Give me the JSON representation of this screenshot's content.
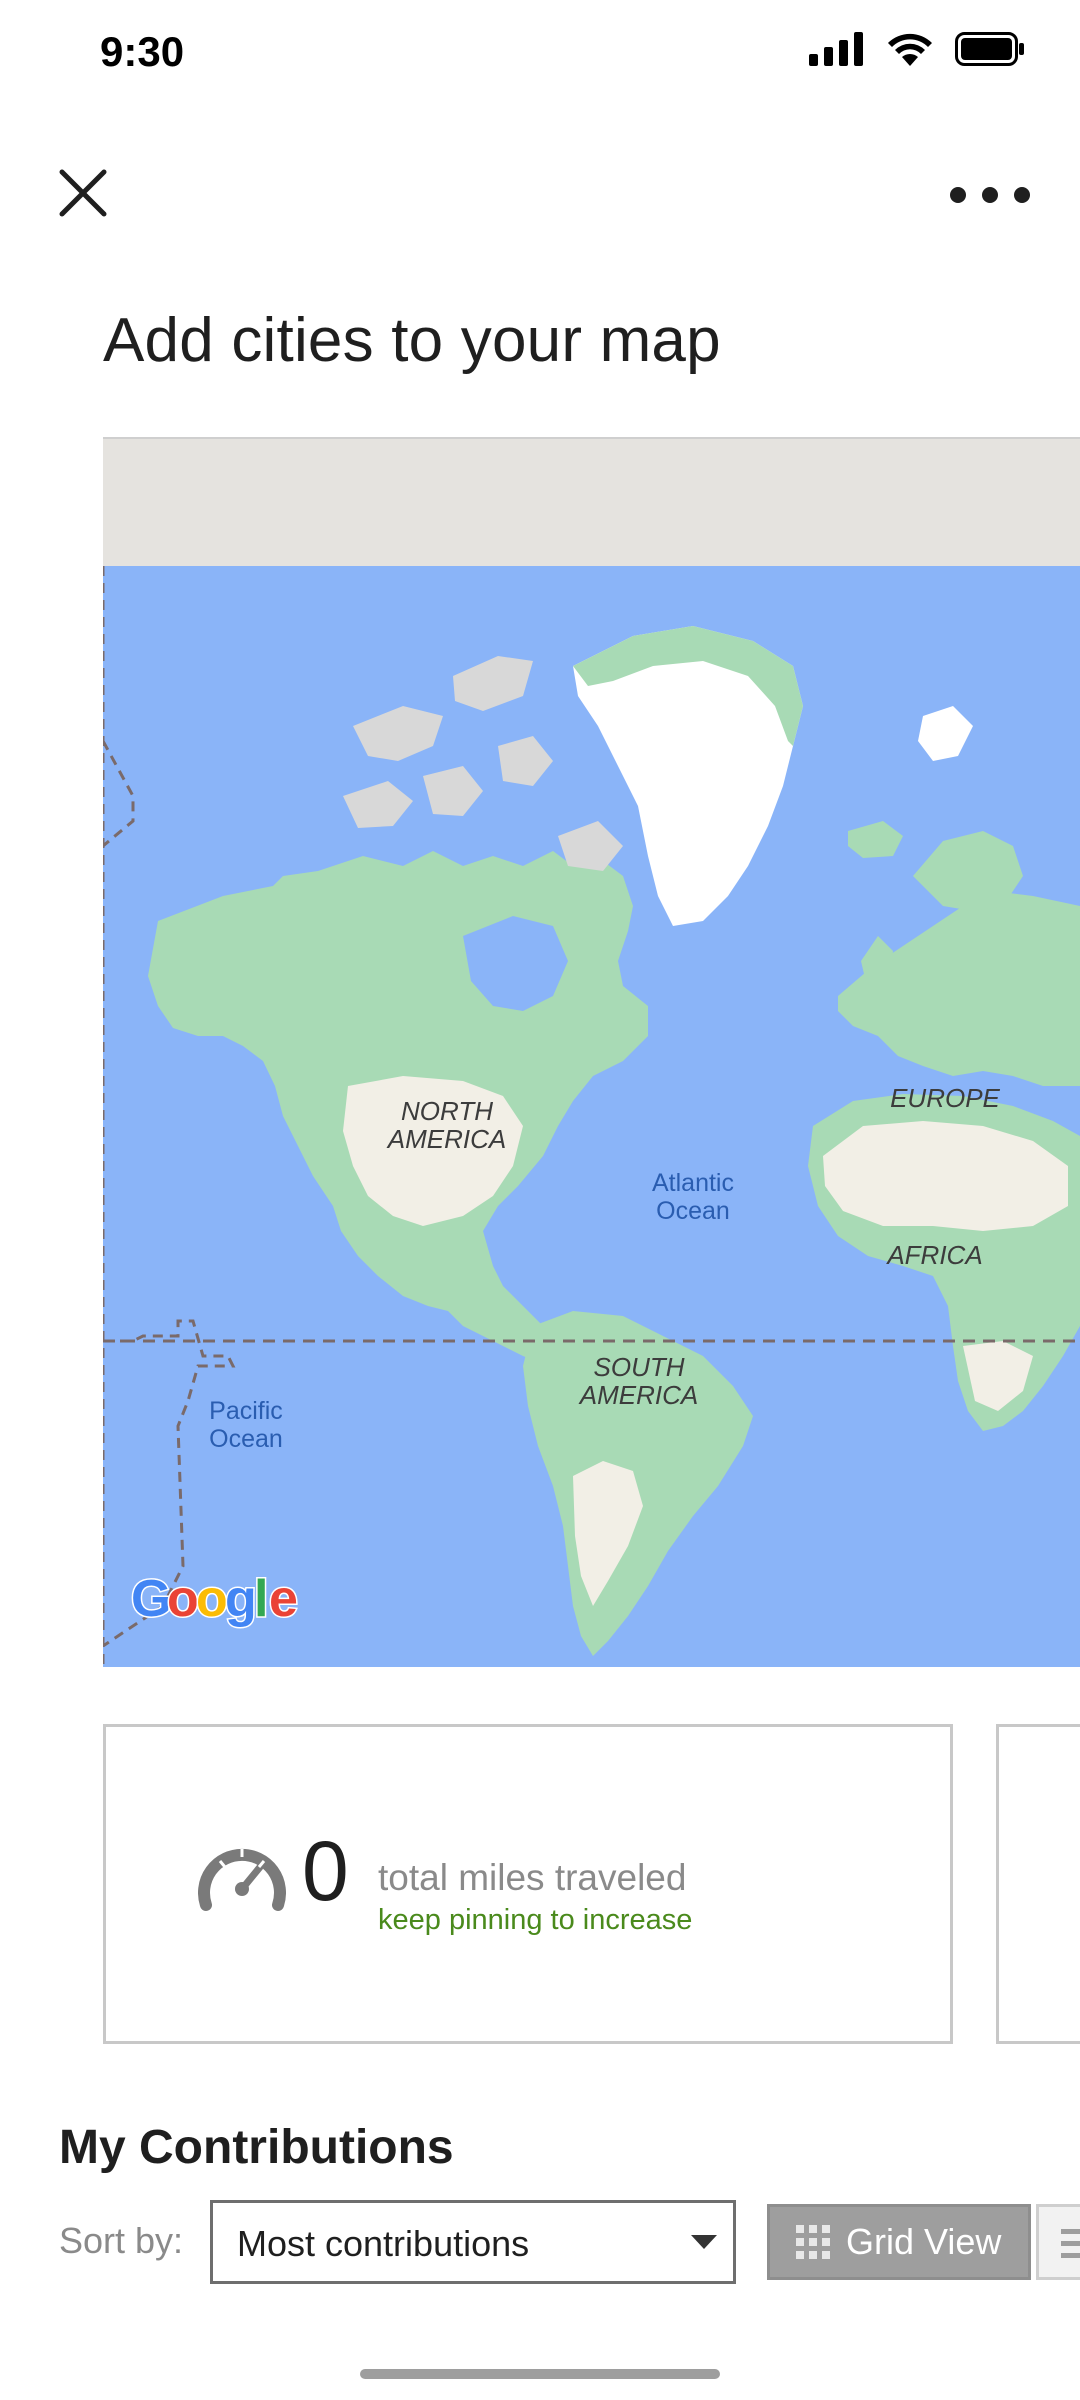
{
  "status_bar": {
    "time": "9:30",
    "icons": [
      "cellular-signal-icon",
      "wifi-icon",
      "battery-icon"
    ]
  },
  "nav": {
    "close_icon": "close-icon",
    "more_icon": "more-horizontal-icon"
  },
  "page_title": "Add cities to your map",
  "map": {
    "labels": {
      "north_america_1": "NORTH",
      "north_america_2": "AMERICA",
      "south_america_1": "SOUTH",
      "south_america_2": "AMERICA",
      "europe": "EUROPE",
      "africa": "AFRICA",
      "atlantic_1": "Atlantic",
      "atlantic_2": "Ocean",
      "pacific_1": "Pacific",
      "pacific_2": "Ocean"
    },
    "logo": "Google",
    "colors": {
      "ocean": "#8ab4f8",
      "land": "#f2efe6",
      "vegetation": "#a8dab5",
      "ice": "#ffffff",
      "border": "#7a6a6a"
    }
  },
  "stats": {
    "icon": "speedometer-icon",
    "value": "0",
    "label": "total miles traveled",
    "sublabel": "keep pinning to increase",
    "sublabel_color": "#4a8a1c"
  },
  "contributions": {
    "title": "My Contributions",
    "sort_label": "Sort by:",
    "sort_value": "Most contributions",
    "grid_view_label": "Grid View",
    "grid_icon": "grid-icon",
    "list_icon": "list-icon"
  }
}
